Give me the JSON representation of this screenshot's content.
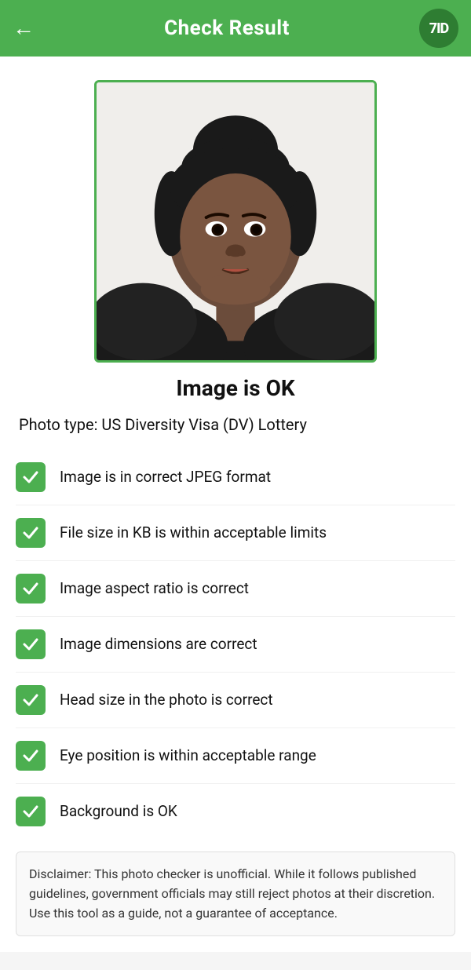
{
  "header": {
    "title": "Check Result",
    "back_label": "←",
    "logo_text": "7ID"
  },
  "status": {
    "title": "Image is OK"
  },
  "photo_type": {
    "label": "Photo type: US Diversity Visa (DV) Lottery"
  },
  "check_items": [
    {
      "id": "jpeg-format",
      "label": "Image is in correct JPEG format"
    },
    {
      "id": "file-size",
      "label": "File size in KB is within acceptable limits"
    },
    {
      "id": "aspect-ratio",
      "label": "Image aspect ratio is correct"
    },
    {
      "id": "dimensions",
      "label": "Image dimensions are correct"
    },
    {
      "id": "head-size",
      "label": "Head size in the photo is correct"
    },
    {
      "id": "eye-position",
      "label": "Eye position is within acceptable range"
    },
    {
      "id": "background",
      "label": "Background is OK"
    }
  ],
  "disclaimer": {
    "text": "Disclaimer: This photo checker is unofficial. While it follows published guidelines, government officials may still reject photos at their discretion. Use this tool as a guide, not a guarantee of acceptance."
  },
  "colors": {
    "green": "#4caf50",
    "dark_green": "#2e7d32"
  }
}
